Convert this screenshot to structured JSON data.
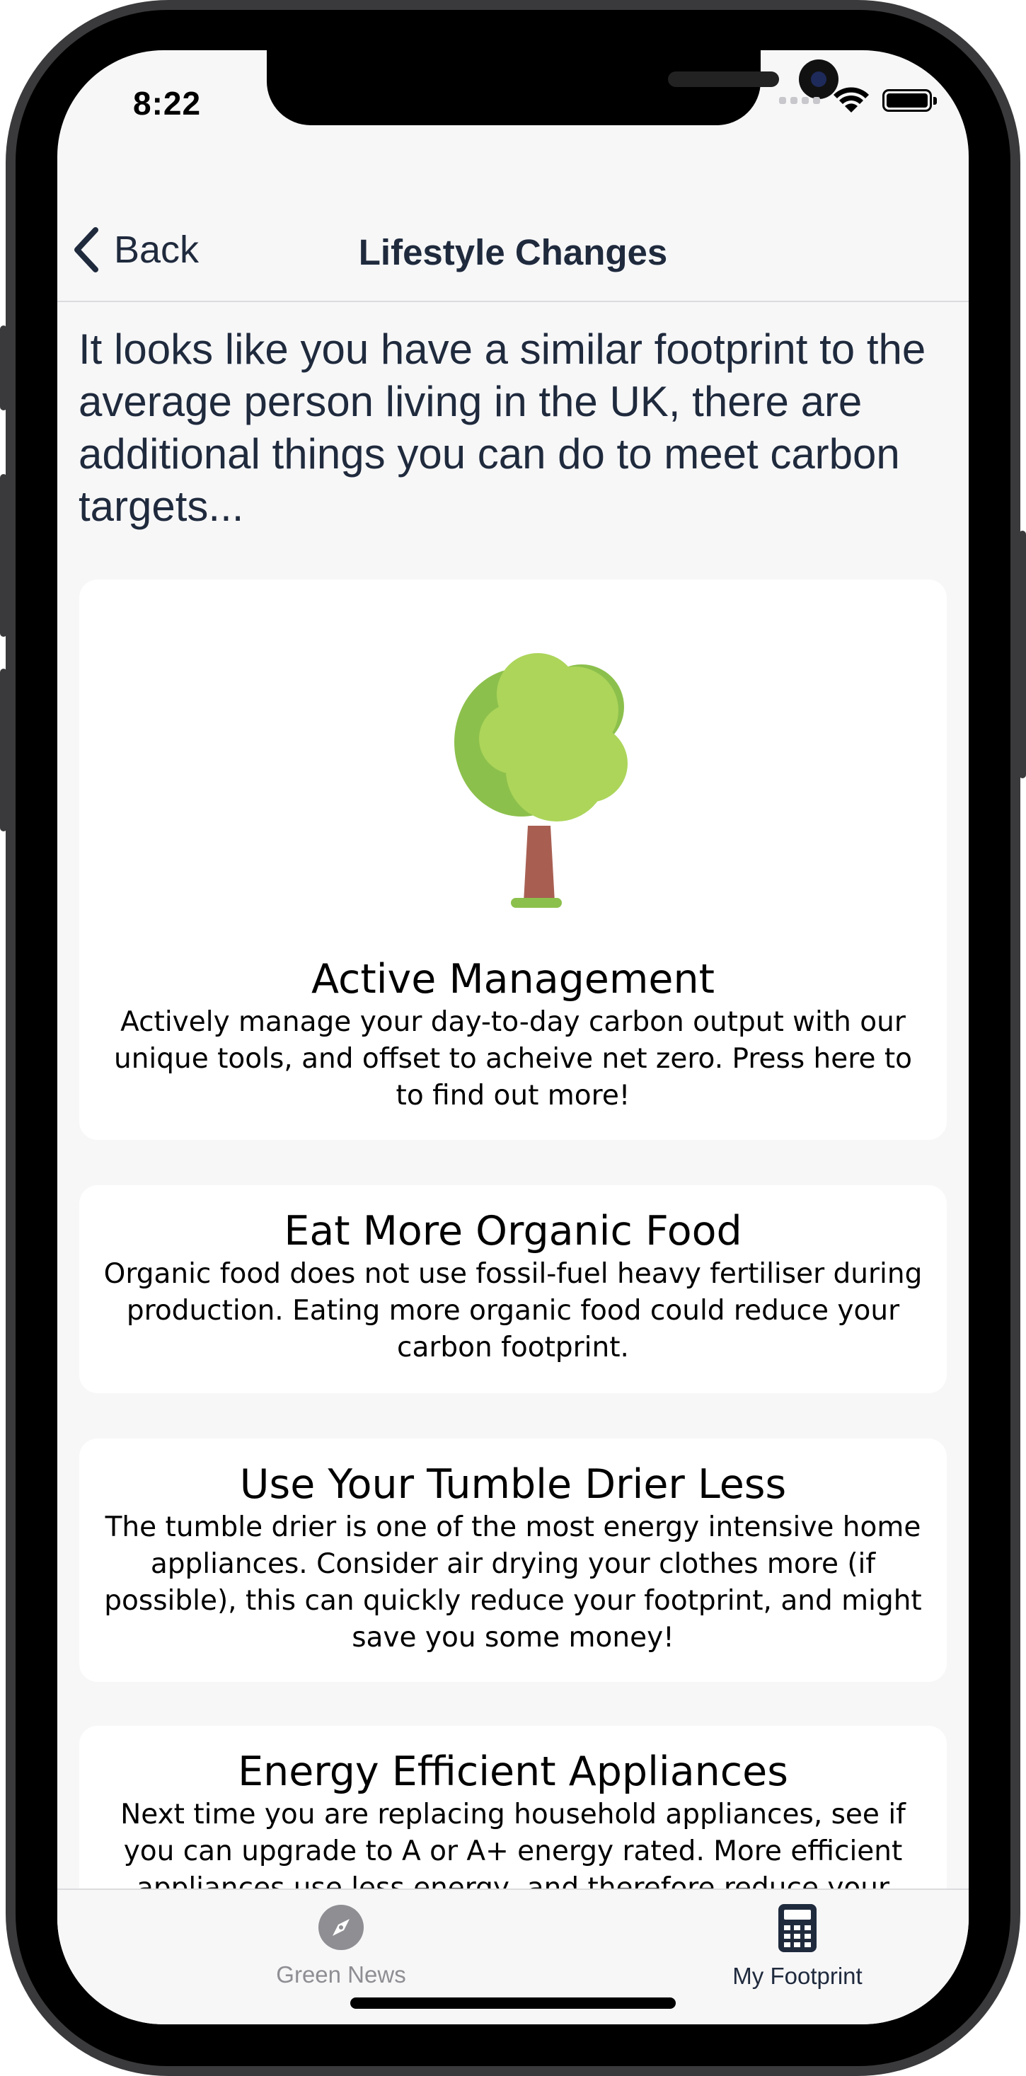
{
  "status_bar": {
    "time": "8:22"
  },
  "navbar": {
    "back_label": "Back",
    "title": "Lifestyle Changes"
  },
  "intro": "It looks like you have a similar footprint to the average person living in the UK, there are additional things you can do to meet carbon targets...",
  "cards": [
    {
      "icon": "tree-icon",
      "title": "Active Management",
      "text": "Actively manage your day-to-day carbon output with our unique tools, and offset to acheive net zero. Press here to to find out more!"
    },
    {
      "title": "Eat More Organic Food",
      "text": "Organic food does not use fossil-fuel heavy fertiliser during production. Eating more organic food could reduce your carbon footprint."
    },
    {
      "title": "Use Your Tumble Drier Less",
      "text": "The tumble drier is one of the most energy intensive home appliances. Consider air drying your clothes more (if possible), this can quickly reduce your footprint, and might save you some money!"
    },
    {
      "title": "Energy Efficient Appliances",
      "text": "Next time you are replacing household appliances, see if you can upgrade to A or A+ energy rated. More efficient appliances use less energy, and therefore reduce your"
    }
  ],
  "tabbar": {
    "tabs": [
      {
        "label": "Green News",
        "icon": "compass-icon",
        "active": false
      },
      {
        "label": "My Footprint",
        "icon": "calculator-icon",
        "active": true
      }
    ]
  },
  "colors": {
    "text_dark": "#1f2a3d",
    "tree_light": "#acd55a",
    "tree_dark": "#8cc04c",
    "trunk": "#a85f52",
    "tab_inactive": "#8e8e93",
    "tab_active": "#1f2a3d"
  }
}
